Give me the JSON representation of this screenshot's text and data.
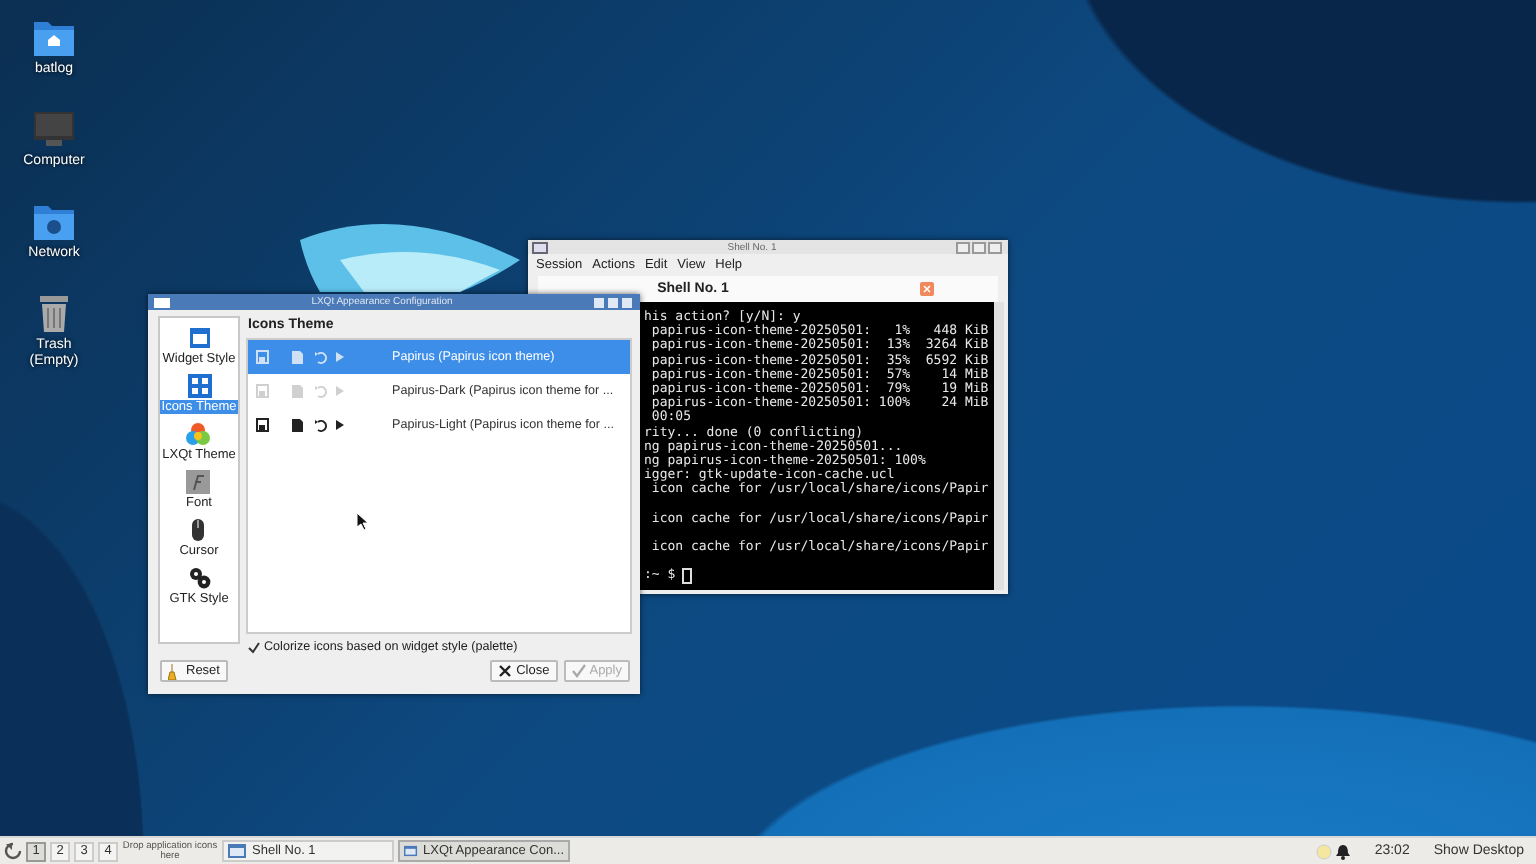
{
  "desktop_icons": [
    {
      "label": "batlog",
      "kind": "home-folder"
    },
    {
      "label": "Computer",
      "kind": "computer"
    },
    {
      "label": "Network",
      "kind": "network-folder"
    },
    {
      "label": "Trash (Empty)",
      "kind": "trash"
    }
  ],
  "terminal": {
    "window_title": "Shell No. 1",
    "menu": [
      "Session",
      "Actions",
      "Edit",
      "View",
      "Help"
    ],
    "tab": "Shell No. 1",
    "output_blocks": [
      [
        "his action? [y/N]: y",
        " papirus-icon-theme-20250501:   1%   448 KiB",
        " papirus-icon-theme-20250501:  13%  3264 KiB",
        " papirus-icon-theme-20250501:  35%  6592 KiB",
        " papirus-icon-theme-20250501:  57%    14 MiB",
        " papirus-icon-theme-20250501:  79%    19 MiB",
        " papirus-icon-theme-20250501: 100%    24 MiB",
        " 00:05",
        "rity... done (0 conflicting)",
        "ng papirus-icon-theme-20250501...",
        "ng papirus-icon-theme-20250501: 100%",
        "igger: gtk-update-icon-cache.ucl",
        " icon cache for /usr/local/share/icons/Papir"
      ],
      [
        " icon cache for /usr/local/share/icons/Papir"
      ],
      [
        " icon cache for /usr/local/share/icons/Papir"
      ],
      [
        ":~ $"
      ]
    ]
  },
  "appearance": {
    "window_title": "LXQt Appearance Configuration",
    "sidebar": [
      {
        "label": "Widget Style",
        "kind": "widget",
        "selected": false
      },
      {
        "label": "Icons Theme",
        "kind": "icons",
        "selected": true
      },
      {
        "label": "LXQt Theme",
        "kind": "theme",
        "selected": false
      },
      {
        "label": "Font",
        "kind": "font",
        "selected": false
      },
      {
        "label": "Cursor",
        "kind": "cursor",
        "selected": false
      },
      {
        "label": "GTK Style",
        "kind": "gtk",
        "selected": false
      }
    ],
    "heading": "Icons Theme",
    "themes": [
      {
        "name": "Papirus (Papirus icon theme)",
        "selected": true,
        "disabled": false
      },
      {
        "name": "Papirus-Dark (Papirus icon theme for ...",
        "selected": false,
        "disabled": true
      },
      {
        "name": "Papirus-Light (Papirus icon theme for ...",
        "selected": false,
        "disabled": false
      }
    ],
    "option": {
      "label": "Colorize icons based on widget style (palette)",
      "checked": true
    },
    "buttons": [
      {
        "label": "Reset",
        "kind": "reset",
        "disabled": false
      },
      {
        "label": "Close",
        "kind": "close",
        "disabled": false
      },
      {
        "label": "Apply",
        "kind": "apply",
        "disabled": true
      }
    ]
  },
  "taskbar": {
    "desktops": [
      {
        "label": "1",
        "selected": true
      },
      {
        "label": "2",
        "selected": false
      },
      {
        "label": "3",
        "selected": false
      },
      {
        "label": "4",
        "selected": false
      }
    ],
    "drop_hint": "Drop application icons here",
    "tasks": [
      {
        "label": "Shell No. 1",
        "selected": false
      },
      {
        "label": "LXQt Appearance Con...",
        "selected": true
      }
    ],
    "clock": "23:02",
    "show_desktop": "Show Desktop"
  }
}
